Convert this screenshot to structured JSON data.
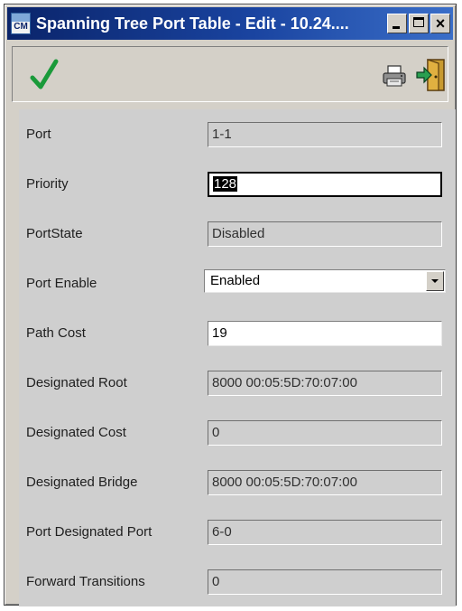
{
  "window": {
    "title": "Spanning Tree Port Table - Edit - 10.24....",
    "icon_text": "CM"
  },
  "toolbar": {
    "icons": [
      "check-icon",
      "printer-icon",
      "exit-icon"
    ],
    "check_color": "#1a9a3a"
  },
  "form": {
    "port": {
      "label": "Port",
      "value": "1-1"
    },
    "priority": {
      "label": "Priority",
      "value": "128"
    },
    "port_state": {
      "label": "PortState",
      "value": "Disabled"
    },
    "port_enable": {
      "label": "Port Enable",
      "value": "Enabled"
    },
    "path_cost": {
      "label": "Path Cost",
      "value": "19"
    },
    "designated_root": {
      "label": "Designated Root",
      "value": "8000 00:05:5D:70:07:00"
    },
    "designated_cost": {
      "label": "Designated Cost",
      "value": "0"
    },
    "designated_bridge": {
      "label": "Designated Bridge",
      "value": "8000 00:05:5D:70:07:00"
    },
    "port_designated_port": {
      "label": "Port Designated Port",
      "value": "6-0"
    },
    "forward_transitions": {
      "label": "Forward Transitions",
      "value": "0"
    }
  }
}
